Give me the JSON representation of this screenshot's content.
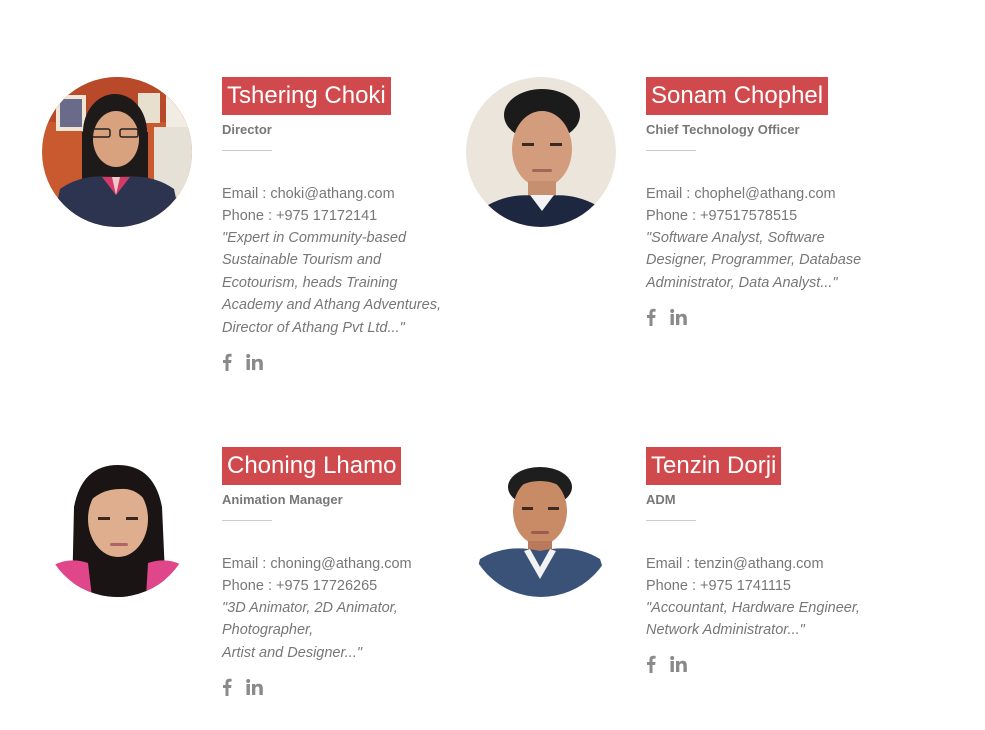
{
  "members": [
    {
      "name": "Tshering Choki",
      "role": "Director",
      "email_label": "Email : choki@athang.com",
      "phone_label": "Phone : +975 17172141",
      "bio": "\"Expert in Community-based\nSustainable Tourism and\nEcotourism, heads Training\nAcademy and Athang Adventures,\nDirector of Athang Pvt Ltd...\"",
      "social_icons": [
        "facebook-icon",
        "linkedin-icon"
      ]
    },
    {
      "name": "Sonam Chophel",
      "role": "Chief Technology Officer",
      "email_label": "Email : chophel@athang.com",
      "phone_label": "Phone : +97517578515",
      "bio": "\"Software Analyst, Software\nDesigner, Programmer, Database\nAdministrator, Data Analyst...\"",
      "social_icons": [
        "facebook-icon",
        "linkedin-icon"
      ]
    },
    {
      "name": "Choning Lhamo",
      "role": "Animation Manager",
      "email_label": "Email : choning@athang.com",
      "phone_label": "Phone : +975 17726265",
      "bio": "\"3D Animator, 2D Animator,\nPhotographer,\nArtist and Designer...\"",
      "social_icons": [
        "facebook-icon",
        "linkedin-icon"
      ]
    },
    {
      "name": "Tenzin Dorji",
      "role": "ADM",
      "email_label": "Email : tenzin@athang.com",
      "phone_label": "Phone : +975 1741115",
      "bio": "\"Accountant, Hardware Engineer,\nNetwork Administrator...\"",
      "social_icons": [
        "facebook-icon",
        "linkedin-icon"
      ]
    }
  ],
  "colors": {
    "name_badge_bg": "#d0494d",
    "name_text": "#ffffff",
    "body_text": "#777777",
    "icon": "#8a8a8a"
  }
}
